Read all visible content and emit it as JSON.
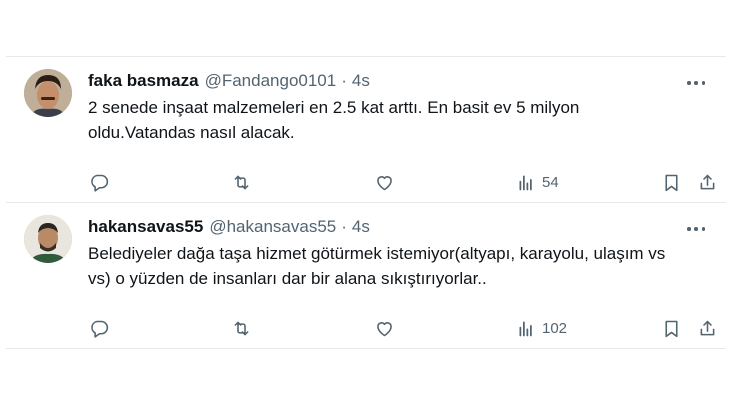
{
  "tweets": [
    {
      "display_name": "faka basmaza",
      "handle": "@Fandango0101",
      "separator": "·",
      "time": "4s",
      "text": "2 senede inşaat malzemeleri en 2.5 kat arttı. En basit ev 5 milyon oldu.Vatandas nasıl alacak.",
      "views": "54",
      "icons": [
        "reply-icon",
        "retweet-icon",
        "like-icon",
        "views-icon",
        "bookmark-icon",
        "share-icon"
      ]
    },
    {
      "display_name": "hakansavas55",
      "handle": "@hakansavas55",
      "separator": "·",
      "time": "4s",
      "text": "Belediyeler dağa taşa hizmet götürmek istemiyor(altyapı, karayolu, ulaşım vs vs) o yüzden de insanları dar bir alana sıkıştırıyorlar..",
      "views": "102",
      "icons": [
        "reply-icon",
        "retweet-icon",
        "like-icon",
        "views-icon",
        "bookmark-icon",
        "share-icon"
      ]
    }
  ],
  "colors": {
    "text": "#0f1419",
    "secondary": "#536471",
    "divider": "#e7e9ec"
  }
}
